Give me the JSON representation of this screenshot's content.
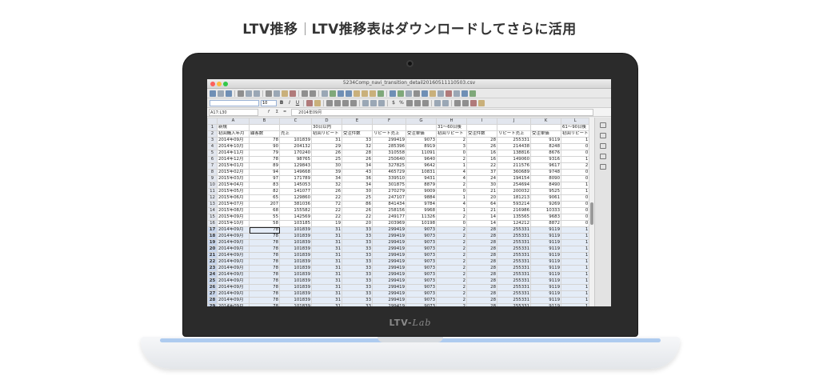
{
  "header": {
    "part1": "LTV推移",
    "part2": "LTV推移表はダウンロードしてさらに活用"
  },
  "laptop": {
    "brand_main": "LTV-",
    "brand_suffix": "Lab"
  },
  "window": {
    "title": "5234Comp_navi_transition_detail20160511110503.csv"
  },
  "toolbar": {
    "font_size": "10"
  },
  "formula_bar": {
    "name_box": "A17:L30",
    "fx": "f",
    "sigma": "Σ",
    "equals": "=",
    "content": "2014年09月"
  },
  "sheet": {
    "columns": [
      "A",
      "B",
      "C",
      "D",
      "E",
      "F",
      "G",
      "H",
      "I",
      "J",
      "K",
      "L"
    ],
    "rows": [
      {
        "n": "1",
        "c": [
          "新規",
          "",
          "",
          "30日以内",
          "",
          "",
          "",
          "31〜60日後",
          "",
          "",
          "",
          "61〜90日後"
        ]
      },
      {
        "n": "2",
        "c": [
          "初回購入年月",
          "顧客数",
          "売上",
          "初回リピート",
          "受注件数",
          "リピート売上",
          "受注単価",
          "初回リピート",
          "受注件数",
          "リピート売上",
          "受注単価",
          "初回リピート"
        ]
      },
      {
        "n": "3",
        "c": [
          "2014年09月",
          "78",
          "101839",
          "31",
          "33",
          "299419",
          "9073",
          "2",
          "28",
          "255331",
          "9119",
          "1"
        ]
      },
      {
        "n": "4",
        "c": [
          "2014年10月",
          "90",
          "204132",
          "29",
          "32",
          "285396",
          "8919",
          "3",
          "26",
          "214438",
          "8248",
          "0"
        ]
      },
      {
        "n": "5",
        "c": [
          "2014年11月",
          "79",
          "170240",
          "26",
          "28",
          "310558",
          "11091",
          "0",
          "16",
          "138816",
          "8676",
          "0"
        ]
      },
      {
        "n": "6",
        "c": [
          "2014年12月",
          "78",
          "98765",
          "25",
          "26",
          "250640",
          "9640",
          "2",
          "16",
          "149060",
          "9316",
          "1"
        ]
      },
      {
        "n": "7",
        "c": [
          "2015年01月",
          "89",
          "129843",
          "30",
          "34",
          "327825",
          "9642",
          "1",
          "22",
          "211576",
          "9617",
          "2"
        ]
      },
      {
        "n": "8",
        "c": [
          "2015年02月",
          "94",
          "149668",
          "39",
          "43",
          "465729",
          "10831",
          "4",
          "37",
          "360689",
          "9748",
          "0"
        ]
      },
      {
        "n": "9",
        "c": [
          "2015年03月",
          "97",
          "171789",
          "34",
          "36",
          "339510",
          "9431",
          "4",
          "24",
          "194154",
          "8090",
          "0"
        ]
      },
      {
        "n": "10",
        "c": [
          "2015年04月",
          "83",
          "145053",
          "32",
          "34",
          "301875",
          "8879",
          "2",
          "30",
          "254694",
          "8490",
          "1"
        ]
      },
      {
        "n": "11",
        "c": [
          "2015年05月",
          "82",
          "141077",
          "26",
          "30",
          "270279",
          "9009",
          "0",
          "21",
          "200032",
          "9525",
          "1"
        ]
      },
      {
        "n": "12",
        "c": [
          "2015年06月",
          "65",
          "129860",
          "22",
          "25",
          "247107",
          "9884",
          "1",
          "20",
          "181213",
          "9061",
          "0"
        ]
      },
      {
        "n": "13",
        "c": [
          "2015年07月",
          "207",
          "381036",
          "72",
          "86",
          "841434",
          "9784",
          "4",
          "64",
          "593214",
          "9269",
          "0"
        ]
      },
      {
        "n": "14",
        "c": [
          "2015年08月",
          "68",
          "155582",
          "22",
          "26",
          "258156",
          "9968",
          "1",
          "21",
          "216986",
          "10333",
          "0"
        ]
      },
      {
        "n": "15",
        "c": [
          "2015年09月",
          "55",
          "142569",
          "22",
          "22",
          "249177",
          "11326",
          "2",
          "14",
          "135565",
          "9683",
          "0"
        ]
      },
      {
        "n": "16",
        "c": [
          "2015年10月",
          "58",
          "103185",
          "19",
          "20",
          "203969",
          "10198",
          "0",
          "14",
          "124212",
          "8872",
          "0"
        ]
      },
      {
        "n": "17",
        "c": [
          "2014年09月",
          "78",
          "101839",
          "31",
          "33",
          "299419",
          "9073",
          "2",
          "28",
          "255331",
          "9119",
          "1"
        ]
      },
      {
        "n": "18",
        "c": [
          "2014年09月",
          "78",
          "101839",
          "31",
          "33",
          "299419",
          "9073",
          "2",
          "28",
          "255331",
          "9119",
          "1"
        ]
      },
      {
        "n": "19",
        "c": [
          "2014年09月",
          "78",
          "101839",
          "31",
          "33",
          "299419",
          "9073",
          "2",
          "28",
          "255331",
          "9119",
          "1"
        ]
      },
      {
        "n": "20",
        "c": [
          "2014年09月",
          "78",
          "101839",
          "31",
          "33",
          "299419",
          "9073",
          "2",
          "28",
          "255331",
          "9119",
          "1"
        ]
      },
      {
        "n": "21",
        "c": [
          "2014年09月",
          "78",
          "101839",
          "31",
          "33",
          "299419",
          "9073",
          "2",
          "28",
          "255331",
          "9119",
          "1"
        ]
      },
      {
        "n": "22",
        "c": [
          "2014年09月",
          "78",
          "101839",
          "31",
          "33",
          "299419",
          "9073",
          "2",
          "28",
          "255331",
          "9119",
          "1"
        ]
      },
      {
        "n": "23",
        "c": [
          "2014年09月",
          "78",
          "101839",
          "31",
          "33",
          "299419",
          "9073",
          "2",
          "28",
          "255331",
          "9119",
          "1"
        ]
      },
      {
        "n": "24",
        "c": [
          "2014年09月",
          "78",
          "101839",
          "31",
          "33",
          "299419",
          "9073",
          "2",
          "28",
          "255331",
          "9119",
          "1"
        ]
      },
      {
        "n": "25",
        "c": [
          "2014年09月",
          "78",
          "101839",
          "31",
          "33",
          "299419",
          "9073",
          "2",
          "28",
          "255331",
          "9119",
          "1"
        ]
      },
      {
        "n": "26",
        "c": [
          "2014年09月",
          "78",
          "101839",
          "31",
          "33",
          "299419",
          "9073",
          "2",
          "28",
          "255331",
          "9119",
          "1"
        ]
      },
      {
        "n": "27",
        "c": [
          "2014年09月",
          "78",
          "101839",
          "31",
          "33",
          "299419",
          "9073",
          "2",
          "28",
          "255331",
          "9119",
          "1"
        ]
      },
      {
        "n": "28",
        "c": [
          "2014年09月",
          "78",
          "101839",
          "31",
          "33",
          "299419",
          "9073",
          "2",
          "28",
          "255331",
          "9119",
          "1"
        ]
      },
      {
        "n": "29",
        "c": [
          "2014年09月",
          "78",
          "101839",
          "31",
          "33",
          "299419",
          "9073",
          "2",
          "28",
          "255331",
          "9119",
          "1"
        ]
      }
    ]
  },
  "colors": {
    "selection": "#e4ecf7",
    "bezel": "#2b2b2b",
    "accent_stripe": "#aecbef"
  }
}
